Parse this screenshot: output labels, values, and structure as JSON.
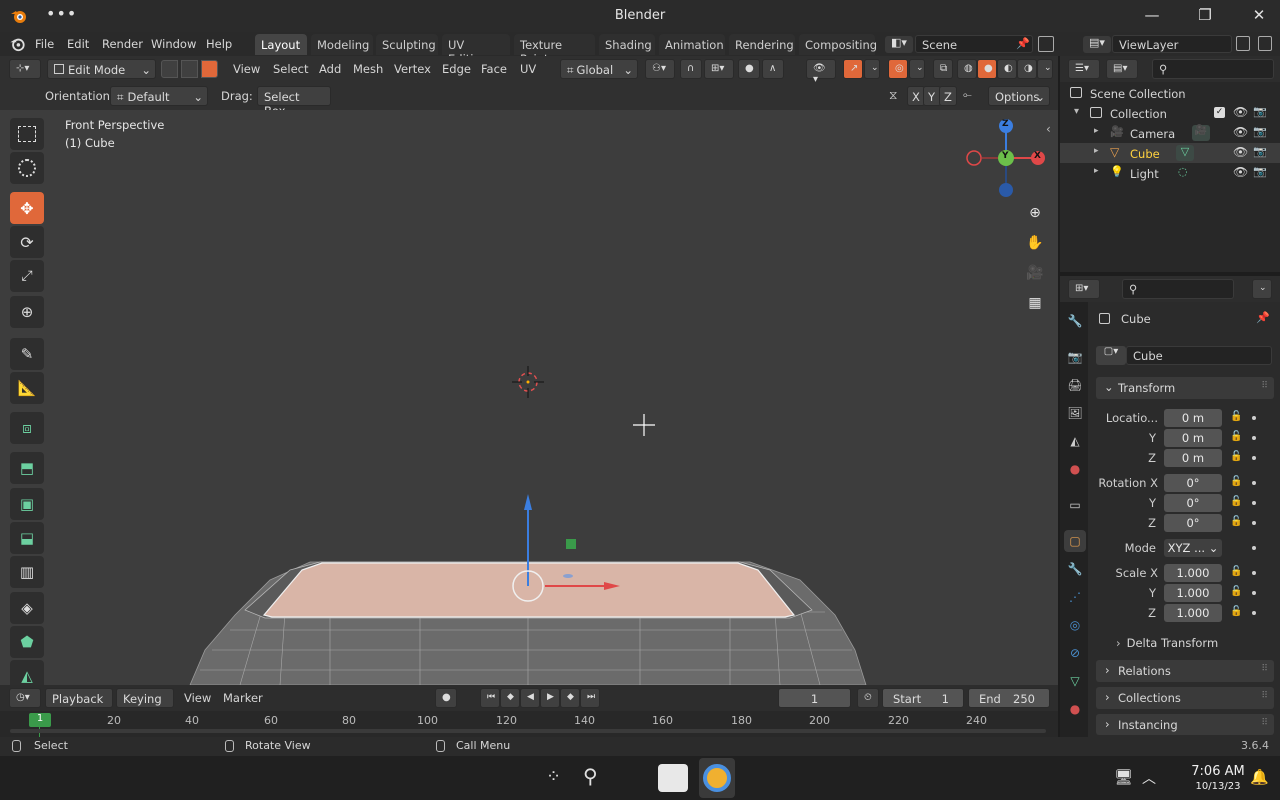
{
  "window": {
    "title": "Blender",
    "controls": [
      "—",
      "❐",
      "✕"
    ]
  },
  "menubar": {
    "items": [
      "File",
      "Edit",
      "Render",
      "Window",
      "Help"
    ],
    "workspaces": [
      "Layout",
      "Modeling",
      "Sculpting",
      "UV Editing",
      "Texture Paint",
      "Shading",
      "Animation",
      "Rendering",
      "Compositing"
    ],
    "active_workspace": "Layout",
    "scene": "Scene",
    "view_layer": "ViewLayer"
  },
  "header": {
    "mode": "Edit Mode",
    "menus": [
      "View",
      "Select",
      "Add",
      "Mesh",
      "Vertex",
      "Edge",
      "Face",
      "UV"
    ],
    "transform_orientation": "Global"
  },
  "subheader": {
    "orientation_label": "Orientation:",
    "orientation_value": "Default",
    "drag_label": "Drag:",
    "drag_value": "Select Box",
    "axes": [
      "X",
      "Y",
      "Z"
    ],
    "options": "Options"
  },
  "viewport": {
    "view_name": "Front Perspective",
    "object_label": "(1) Cube",
    "gizmo_axes": {
      "z": "Z",
      "y": "Y",
      "x": "X"
    }
  },
  "timeline": {
    "menus": [
      "Playback",
      "Keying",
      "View",
      "Marker"
    ],
    "current_frame": "1",
    "start_label": "Start",
    "start": "1",
    "end_label": "End",
    "end": "250",
    "ticks": [
      "1",
      "20",
      "40",
      "60",
      "80",
      "100",
      "120",
      "140",
      "160",
      "180",
      "200",
      "220",
      "240"
    ]
  },
  "statusbar": {
    "items": [
      "Select",
      "Rotate View",
      "Call Menu"
    ],
    "version": "3.6.4"
  },
  "outliner": {
    "root": "Scene Collection",
    "collection": "Collection",
    "items": [
      {
        "name": "Camera",
        "color": "#d6d6d6"
      },
      {
        "name": "Cube",
        "color": "#ffd23f"
      },
      {
        "name": "Light",
        "color": "#d6d6d6"
      }
    ]
  },
  "properties": {
    "object_name": "Cube",
    "data_name": "Cube",
    "transform_title": "Transform",
    "location_label": "Locatio...",
    "location": [
      "0 m",
      "0 m",
      "0 m"
    ],
    "rotation_label": "Rotation X",
    "rotation": [
      "0°",
      "0°",
      "0°"
    ],
    "mode_label": "Mode",
    "mode_value": "XYZ ...",
    "scale_label": "Scale X",
    "scale": [
      "1.000",
      "1.000",
      "1.000"
    ],
    "axis_y": "Y",
    "axis_z": "Z",
    "delta_transform": "Delta Transform",
    "panels": [
      "Relations",
      "Collections",
      "Instancing"
    ]
  },
  "taskbar": {
    "time": "7:06 AM",
    "date": "10/13/23"
  },
  "colors": {
    "accent": "#e0683a",
    "viewport_bg": "#3d3d3d",
    "selected_text": "#ffd23f",
    "x_axis": "#e04848",
    "y_axis": "#6cc04a",
    "z_axis": "#3b7ee0"
  }
}
